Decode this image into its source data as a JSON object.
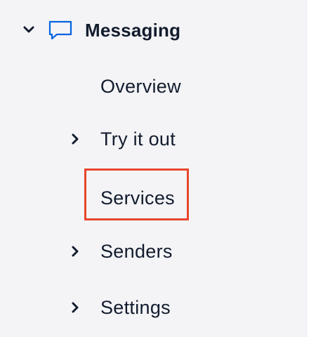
{
  "sidebar": {
    "section": {
      "title": "Messaging",
      "expand_icon": "chevron-down-icon",
      "icon": "chat-bubble-icon",
      "icon_color": "#0263e0"
    },
    "items": [
      {
        "label": "Overview",
        "has_children": false
      },
      {
        "label": "Try it out",
        "has_children": true,
        "expand_icon": "chevron-right-icon"
      },
      {
        "label": "Services",
        "has_children": false,
        "highlighted": true
      },
      {
        "label": "Senders",
        "has_children": true,
        "expand_icon": "chevron-right-icon"
      },
      {
        "label": "Settings",
        "has_children": true,
        "expand_icon": "chevron-right-icon"
      }
    ]
  },
  "colors": {
    "sidebar_bg": "#f4f4f7",
    "text": "#121c2d",
    "highlight": "#e8462c",
    "accent": "#0263e0"
  }
}
